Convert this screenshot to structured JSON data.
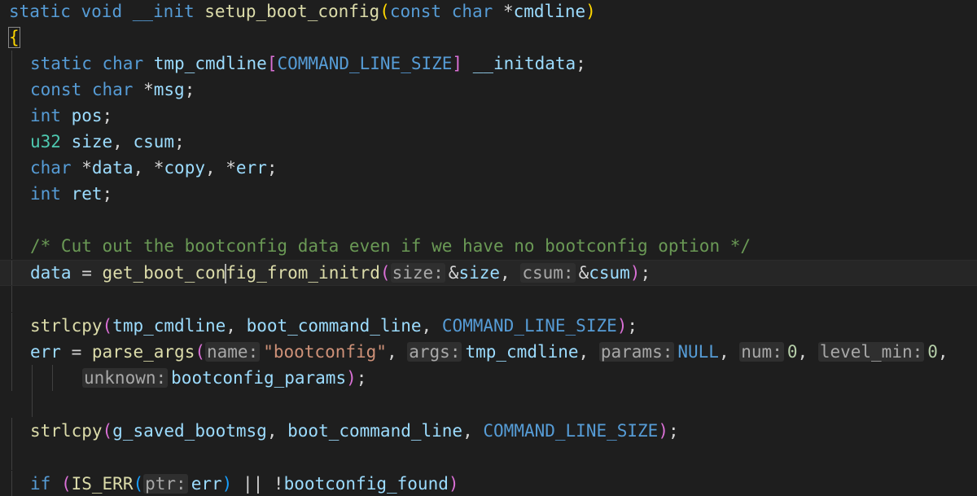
{
  "editor": {
    "lines": [
      {
        "signature": [
          "static",
          "void",
          "__init",
          "setup_boot_config",
          "(",
          "const",
          "char",
          "*",
          "cmdline",
          ")"
        ]
      },
      {
        "open_brace": "{"
      },
      {
        "decl": [
          "static",
          "char",
          "tmp_cmdline",
          "[",
          "COMMAND_LINE_SIZE",
          "]",
          "__initdata",
          ";"
        ]
      },
      {
        "decl": [
          "const",
          "char",
          "*",
          "msg",
          ";"
        ]
      },
      {
        "decl": [
          "int",
          "pos",
          ";"
        ]
      },
      {
        "decl": [
          "u32",
          "size",
          ",",
          "csum",
          ";"
        ]
      },
      {
        "decl": [
          "char",
          "*",
          "data",
          ", *",
          "copy",
          ", *",
          "err",
          ";"
        ]
      },
      {
        "decl": [
          "int",
          "ret",
          ";"
        ]
      },
      {
        "comment": "/* Cut out the bootconfig data even if we have no bootconfig option */"
      },
      {
        "stmt": [
          "data",
          "=",
          "get_boot_con",
          "fig_from_initrd",
          "(",
          "size:",
          "&",
          "size",
          ",",
          "csum:",
          "&",
          "csum",
          ")",
          ";"
        ]
      },
      {
        "stmt": [
          "strlcpy",
          "(",
          "tmp_cmdline",
          ",",
          "boot_command_line",
          ",",
          "COMMAND_LINE_SIZE",
          ")",
          ";"
        ]
      },
      {
        "stmt": [
          "err",
          "=",
          "parse_args",
          "(",
          "name:",
          "\"bootconfig\"",
          ",",
          "args:",
          "tmp_cmdline",
          ",",
          "params:",
          "NULL",
          ",",
          "num:",
          "0",
          ",",
          "level_min:",
          "0",
          ","
        ]
      },
      {
        "stmt": [
          "unknown:",
          "bootconfig_params",
          ")",
          ";"
        ]
      },
      {
        "stmt": [
          "strlcpy",
          "(",
          "g_saved_bootmsg",
          ",",
          "boot_command_line",
          ",",
          "COMMAND_LINE_SIZE",
          ")",
          ";"
        ]
      },
      {
        "stmt": [
          "if",
          "(",
          "IS_ERR",
          "(",
          "ptr:",
          "err",
          ")",
          "||",
          "!",
          "bootconfig_found",
          ")"
        ]
      }
    ]
  },
  "colors": {
    "background": "#1e1e1e",
    "keyword": "#569cd6",
    "type": "#4ec9b0",
    "function": "#dcdcaa",
    "variable": "#9cdcfe",
    "string": "#ce9178",
    "number": "#b5cea8",
    "comment": "#6a9955",
    "bracket_gold": "#ffd700",
    "bracket_orchid": "#da70d6",
    "bracket_blue": "#179fff"
  }
}
